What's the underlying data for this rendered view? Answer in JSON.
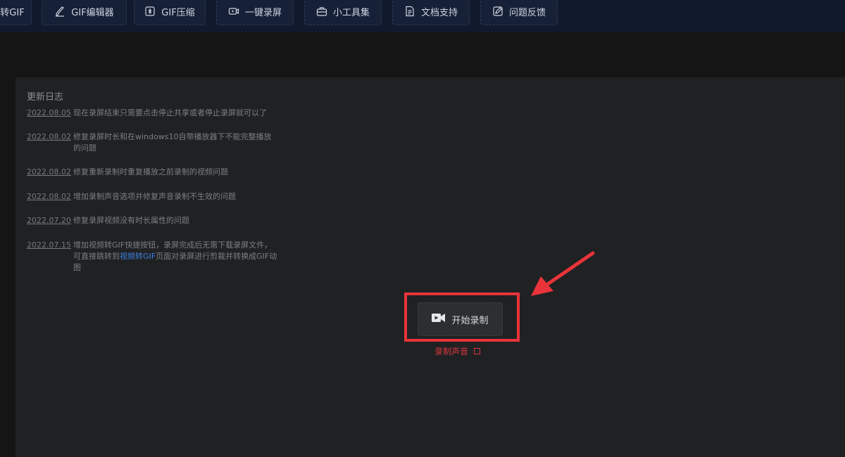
{
  "nav": {
    "items": [
      {
        "label": "转GIF",
        "icon": "convert-icon"
      },
      {
        "label": "GIF编辑器",
        "icon": "brush-icon"
      },
      {
        "label": "GIF压缩",
        "icon": "compress-icon"
      },
      {
        "label": "一键录屏",
        "icon": "video-icon"
      },
      {
        "label": "小工具集",
        "icon": "toolbox-icon"
      },
      {
        "label": "文档支持",
        "icon": "document-icon"
      },
      {
        "label": "问题反馈",
        "icon": "feedback-icon"
      }
    ]
  },
  "changelog": {
    "title": "更新日志",
    "entries": [
      {
        "date": "2022.08.05",
        "text": "现在录屏结束只需要点击停止共享或者停止录屏就可以了"
      },
      {
        "date": "2022.08.02",
        "text": "修复录屏时长和在windows10自带播放器下不能完整播放的问题"
      },
      {
        "date": "2022.08.02",
        "text": "修复重新录制时重复播放之前录制的视频问题"
      },
      {
        "date": "2022.08.02",
        "text": "增加录制声音选项并修复声音录制不生效的问题"
      },
      {
        "date": "2022.07.20",
        "text": "修复录屏视频没有时长属性的问题"
      },
      {
        "date": "2022.07.15",
        "text_before": "增加视频转GIF快捷按钮，录屏完成后无需下载录屏文件，可直接跳转到",
        "link": "视频转GIF",
        "text_after": "页面对录屏进行剪裁并转换成GIF动图"
      }
    ]
  },
  "recorder": {
    "start_label": "开始录制",
    "audio_label": "录制声音",
    "audio_checked": false
  },
  "colors": {
    "accent_red": "#e8343a",
    "link_blue": "#3d7fe0"
  }
}
